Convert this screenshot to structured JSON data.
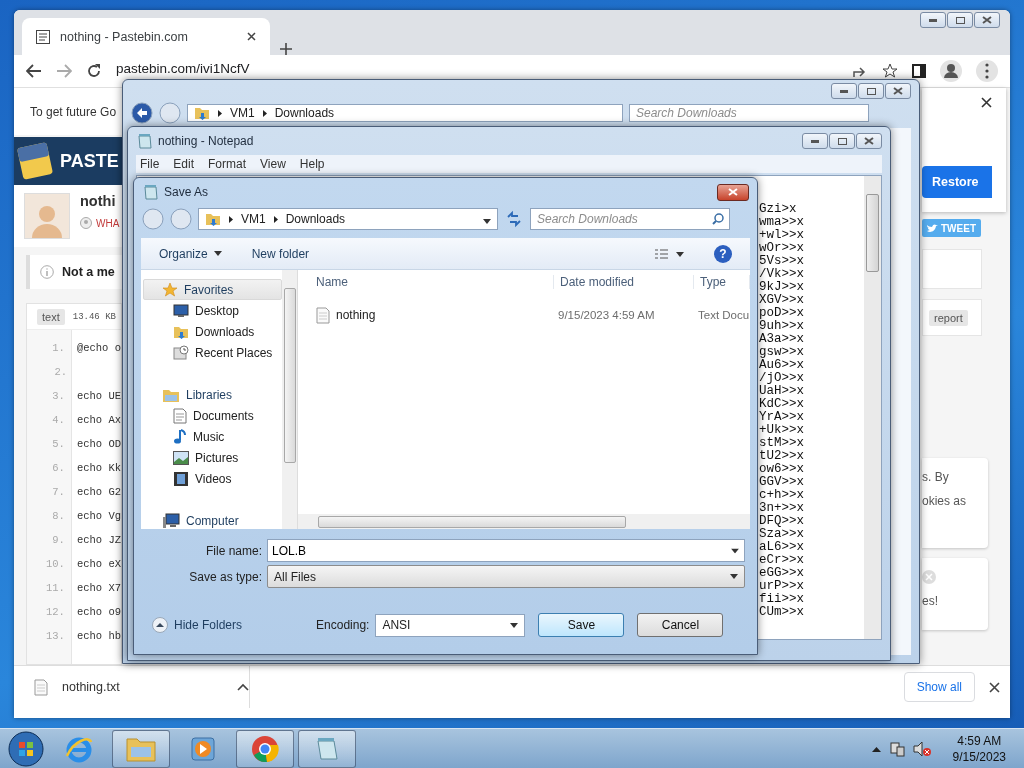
{
  "browser": {
    "tab": {
      "title": "nothing - Pastebin.com"
    },
    "address": "pastebin.com/ivi1NcfV",
    "notice": "To get future Go",
    "logo_text": "PASTE",
    "paste_title": "nothi",
    "author": "WHA",
    "alert": "Not a me",
    "syntax": "text",
    "size": "13.46 KB",
    "lines": [
      {
        "number": "1.",
        "code": "@echo o"
      },
      {
        "number": "2."
      },
      {
        "number": "3.",
        "code": "echo UE"
      },
      {
        "number": "4.",
        "code": "echo Ax"
      },
      {
        "number": "5.",
        "code": "echo OD"
      },
      {
        "number": "6.",
        "code": "echo Kk"
      },
      {
        "number": "7.",
        "code": "echo G2"
      },
      {
        "number": "8.",
        "code": "echo Vg"
      },
      {
        "number": "9.",
        "code": "echo JZ"
      },
      {
        "number": "10.",
        "code": "echo eX"
      },
      {
        "number": "11.",
        "code": "echo X7"
      },
      {
        "number": "12.",
        "code": "echo o9"
      },
      {
        "number": "13.",
        "code": "echo hb"
      }
    ],
    "side": {
      "restore": "Restore",
      "tweet": "TWEET",
      "report": "report",
      "cookie_lines": [
        "s. By",
        "okies as"
      ],
      "promo": "es!"
    },
    "downloads": {
      "file": "nothing.txt",
      "show_all": "Show all"
    }
  },
  "explorer": {
    "path": [
      "VM1",
      "Downloads"
    ],
    "search_placeholder": "Search Downloads"
  },
  "notepad": {
    "title": "nothing - Notepad",
    "menu": [
      "File",
      "Edit",
      "Format",
      "View",
      "Help"
    ],
    "lines": [
      "Gzi>x",
      "wma>>x",
      "+wl>>x",
      "wOr>>x",
      "5Vs>>x",
      "/Vk>>x",
      "9kJ>>x",
      "XGV>>x",
      "poD>>x",
      "9uh>>x",
      "A3a>>x",
      "gsw>>x",
      "Au6>>x",
      "/jO>>x",
      "UaH>>x",
      "KdC>>x",
      "YrA>>x",
      "+Uk>>x",
      "stM>>x",
      "tU2>>x",
      "ow6>>x",
      "GGV>>x",
      "c+h>>x",
      "3n+>>x",
      "DFQ>>x",
      "Sza>>x",
      "aL6>>x",
      "eCr>>x",
      "eGG>>x",
      "urP>>x",
      "fii>>x",
      "CUm>>x"
    ]
  },
  "save_dialog": {
    "title": "Save As",
    "path": [
      "VM1",
      "Downloads"
    ],
    "search_placeholder": "Search Downloads",
    "toolbar": [
      "Organize",
      "New folder"
    ],
    "help": "?",
    "nav": [
      {
        "label": "Favorites",
        "kind": "group",
        "selected": true
      },
      {
        "label": "Desktop",
        "kind": "item",
        "selected": false
      },
      {
        "label": "Downloads",
        "kind": "item",
        "selected": false
      },
      {
        "label": "Recent Places",
        "kind": "item",
        "selected": false
      },
      {
        "label": "Libraries",
        "kind": "group",
        "selected": false
      },
      {
        "label": "Documents",
        "kind": "item",
        "selected": false
      },
      {
        "label": "Music",
        "kind": "item",
        "selected": false
      },
      {
        "label": "Pictures",
        "kind": "item",
        "selected": false
      },
      {
        "label": "Videos",
        "kind": "item",
        "selected": false
      },
      {
        "label": "Computer",
        "kind": "group",
        "selected": false
      }
    ],
    "columns": [
      "Name",
      "Date modified",
      "Type"
    ],
    "files": [
      {
        "name": "nothing",
        "date": "9/15/2023 4:59 AM",
        "type": "Text Docu"
      }
    ],
    "file_name_label": "File name:",
    "file_name": "LOL.B",
    "type_label": "Save as type:",
    "save_as_type": "All Files",
    "hide_folders": "Hide Folders",
    "encoding_label": "Encoding:",
    "encoding": "ANSI",
    "buttons": [
      "Save",
      "Cancel"
    ]
  },
  "taskbar": {
    "apps": [
      {
        "kind": "ie",
        "running": false
      },
      {
        "kind": "explorer",
        "running": true
      },
      {
        "kind": "media",
        "running": false
      },
      {
        "kind": "chrome",
        "running": true
      },
      {
        "kind": "notepad",
        "running": true
      }
    ],
    "time": "4:59 AM",
    "date": "9/15/2023"
  }
}
